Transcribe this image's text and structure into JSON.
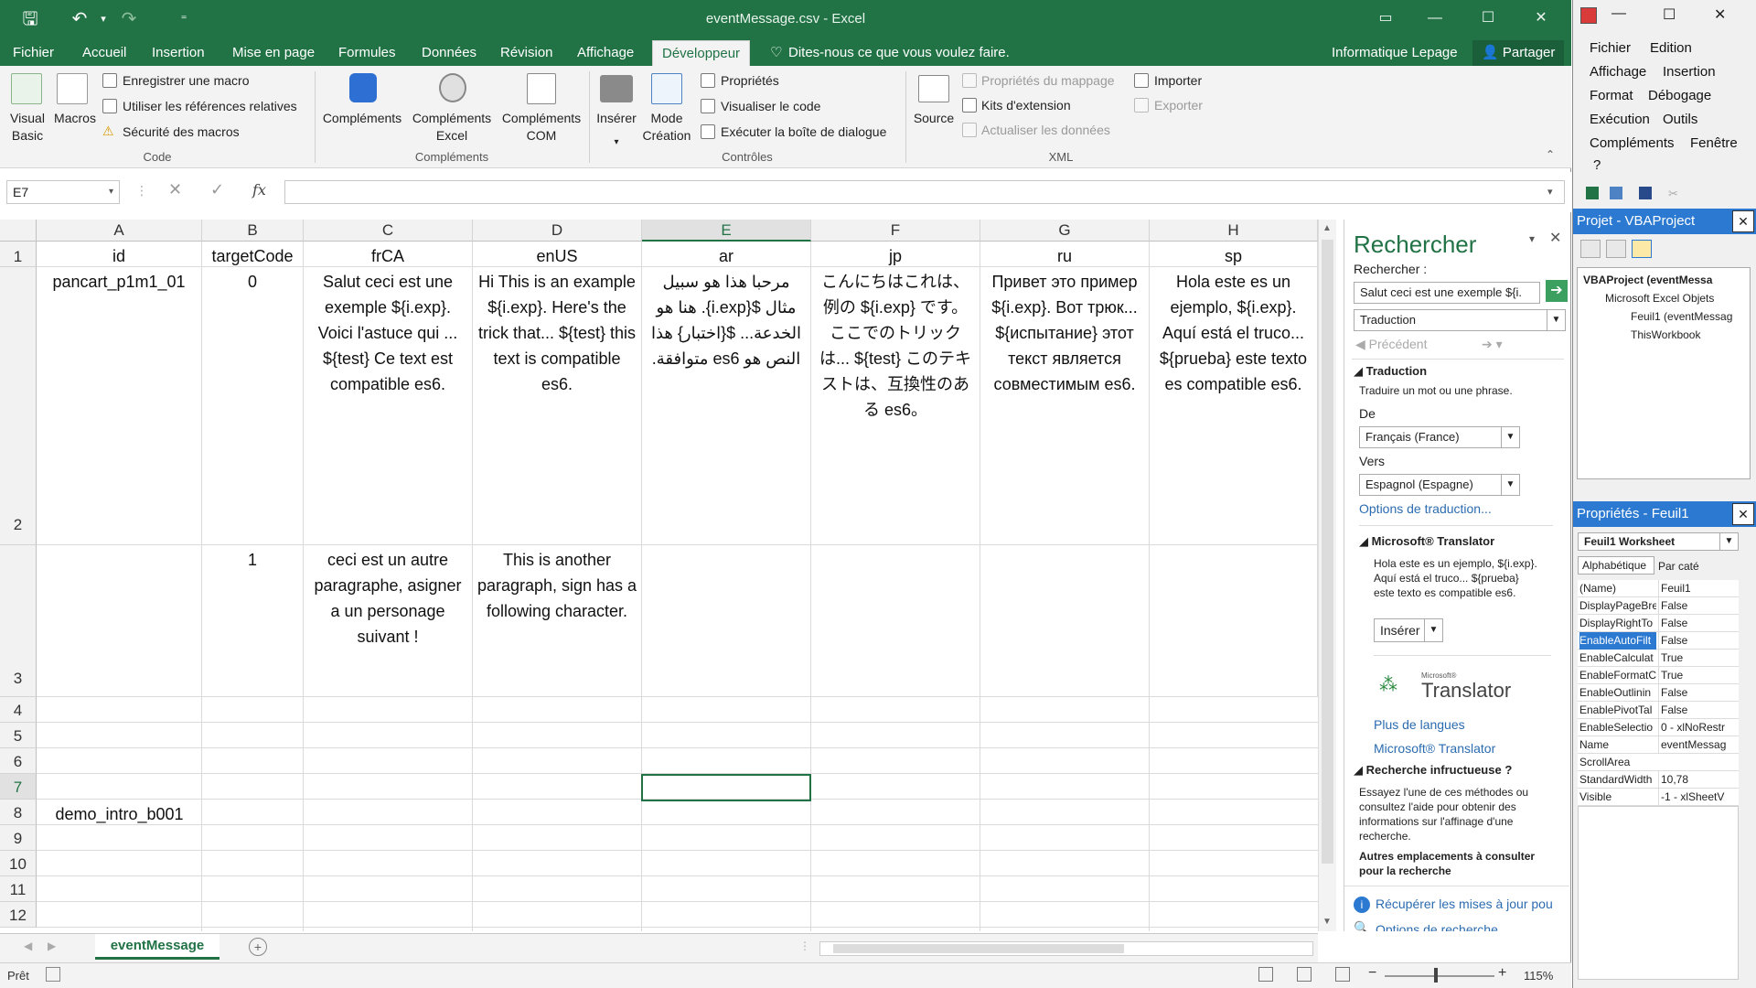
{
  "window": {
    "title": "eventMessage.csv - Excel"
  },
  "ribbon_tabs": [
    "Fichier",
    "Accueil",
    "Insertion",
    "Mise en page",
    "Formules",
    "Données",
    "Révision",
    "Affichage",
    "Développeur"
  ],
  "tell_me": "Dites-nous ce que vous voulez faire.",
  "account": "Informatique Lepage",
  "share": "Partager",
  "ribbon": {
    "code": {
      "visual_basic": "Visual Basic",
      "macros": "Macros",
      "record_macro": "Enregistrer une macro",
      "relative_refs": "Utiliser les références relatives",
      "macro_security": "Sécurité des macros",
      "group": "Code"
    },
    "addins": {
      "complements": "Compléments",
      "complements_excel": "Compléments Excel",
      "complements_com": "Compléments COM",
      "group": "Compléments"
    },
    "controls": {
      "insert": "Insérer",
      "design_mode": "Mode Création",
      "properties": "Propriétés",
      "view_code": "Visualiser le code",
      "run_dialog": "Exécuter la boîte de dialogue",
      "group": "Contrôles"
    },
    "xml": {
      "source": "Source",
      "map_props": "Propriétés du mappage",
      "expansion_packs": "Kits d'extension",
      "refresh_data": "Actualiser les données",
      "import": "Importer",
      "export": "Exporter",
      "group": "XML"
    }
  },
  "name_box": "E7",
  "formula_fx": "fx",
  "columns": [
    "A",
    "B",
    "C",
    "D",
    "E",
    "F",
    "G",
    "H"
  ],
  "rows": [
    "1",
    "2",
    "3",
    "4",
    "5",
    "6",
    "7",
    "8",
    "9",
    "10",
    "11",
    "12"
  ],
  "cells": {
    "r1": [
      "id",
      "targetCode",
      "frCA",
      "enUS",
      "ar",
      "jp",
      "ru",
      "sp"
    ],
    "r2": [
      "pancart_p1m1_01",
      "0",
      "Salut ceci est une exemple ${i.exp}. Voici l'astuce qui ... ${test}  Ce text est compatible es6.",
      "Hi This is an example ${i.exp}. Here's the trick that... ${test} this text is compatible es6.",
      "مرحبا هذا هو سبيل مثال ${i.exp}. هنا هو الخدعة... ${اختبار} هذا النص هو es6 متوافقة.",
      "こんにちはこれは、例の ${i.exp} です。ここでのトリックは... ${test} このテキストは、互換性のある es6。",
      "Привет это пример ${i.exp}. Вот трюк... ${испытание} этот текст является совместимым es6.",
      "Hola este es un ejemplo, ${i.exp}. Aquí está el truco... ${prueba} este texto es compatible es6."
    ],
    "r3": [
      "",
      "1",
      "ceci est un autre paragraphe, asigner a un personage suivant !",
      "This is another paragraph, sign has a following character.",
      "",
      "",
      "",
      ""
    ],
    "r8": [
      "demo_intro_b001",
      "",
      "",
      "",
      "",
      "",
      "",
      ""
    ]
  },
  "sheet_tab": "eventMessage",
  "status": {
    "ready": "Prêt",
    "zoom": "115%"
  },
  "research": {
    "title": "Rechercher",
    "search_label": "Rechercher :",
    "search_value": "Salut ceci est une exemple ${i.",
    "service": "Traduction",
    "previous": "Précédent",
    "section_translation": "Traduction",
    "translate_desc": "Traduire un mot ou une phrase.",
    "from_label": "De",
    "from_value": "Français (France)",
    "to_label": "Vers",
    "to_value": "Espagnol (Espagne)",
    "options_link": "Options de traduction...",
    "ms_translator": "Microsoft® Translator",
    "result": "Hola este es un ejemplo, ${i.exp}. Aquí está el truco... ${prueba} este texto es compatible es6.",
    "insert": "Insérer",
    "logo_small": "Microsoft®",
    "logo_big": "Translator",
    "more_languages": "Plus de langues",
    "ms_translator_link": "Microsoft® Translator",
    "failed_title": "Recherche infructueuse ?",
    "failed_desc": "Essayez l'une de ces méthodes ou consultez l'aide pour obtenir des informations sur l'affinage d'une recherche.",
    "other_places": "Autres emplacements à consulter pour la recherche",
    "updates": "Récupérer les mises à jour pou",
    "search_options": "Options de recherche..."
  },
  "vba": {
    "menu": [
      "Fichier",
      "Edition",
      "Affichage",
      "Insertion",
      "Format",
      "Débogage",
      "Exécution",
      "Outils",
      "Compléments",
      "Fenêtre",
      "?"
    ],
    "project_title": "Projet - VBAProject",
    "tree": [
      "VBAProject (eventMessa",
      "Microsoft Excel Objets",
      "Feuil1 (eventMessag",
      "ThisWorkbook"
    ],
    "props_title": "Propriétés - Feuil1",
    "object": "Feuil1 Worksheet",
    "tab_alpha": "Alphabétique",
    "tab_cat": "Par caté",
    "properties": [
      {
        "k": "(Name)",
        "v": "Feuil1"
      },
      {
        "k": "DisplayPageBre",
        "v": "False"
      },
      {
        "k": "DisplayRightTo",
        "v": "False"
      },
      {
        "k": "EnableAutoFilt",
        "v": "False"
      },
      {
        "k": "EnableCalculat",
        "v": "True"
      },
      {
        "k": "EnableFormatC",
        "v": "True"
      },
      {
        "k": "EnableOutlinin",
        "v": "False"
      },
      {
        "k": "EnablePivotTal",
        "v": "False"
      },
      {
        "k": "EnableSelectio",
        "v": "0 - xlNoRestr"
      },
      {
        "k": "Name",
        "v": "eventMessag"
      },
      {
        "k": "ScrollArea",
        "v": ""
      },
      {
        "k": "StandardWidth",
        "v": "10,78"
      },
      {
        "k": "Visible",
        "v": "-1 - xlSheetV"
      }
    ]
  },
  "colors": {
    "excel_green": "#217346",
    "link": "#2b6cb0",
    "vba_title": "#2b79d0"
  }
}
